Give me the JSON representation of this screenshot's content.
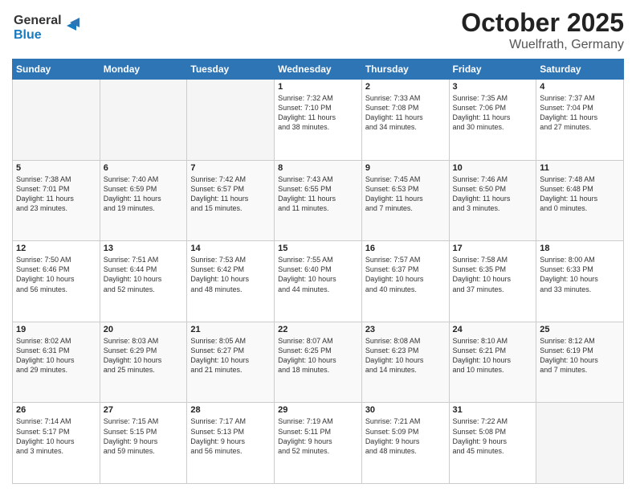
{
  "header": {
    "logo_line1": "General",
    "logo_line2": "Blue",
    "title": "October 2025",
    "subtitle": "Wuelfrath, Germany"
  },
  "days_of_week": [
    "Sunday",
    "Monday",
    "Tuesday",
    "Wednesday",
    "Thursday",
    "Friday",
    "Saturday"
  ],
  "weeks": [
    [
      {
        "day": "",
        "info": ""
      },
      {
        "day": "",
        "info": ""
      },
      {
        "day": "",
        "info": ""
      },
      {
        "day": "1",
        "info": "Sunrise: 7:32 AM\nSunset: 7:10 PM\nDaylight: 11 hours\nand 38 minutes."
      },
      {
        "day": "2",
        "info": "Sunrise: 7:33 AM\nSunset: 7:08 PM\nDaylight: 11 hours\nand 34 minutes."
      },
      {
        "day": "3",
        "info": "Sunrise: 7:35 AM\nSunset: 7:06 PM\nDaylight: 11 hours\nand 30 minutes."
      },
      {
        "day": "4",
        "info": "Sunrise: 7:37 AM\nSunset: 7:04 PM\nDaylight: 11 hours\nand 27 minutes."
      }
    ],
    [
      {
        "day": "5",
        "info": "Sunrise: 7:38 AM\nSunset: 7:01 PM\nDaylight: 11 hours\nand 23 minutes."
      },
      {
        "day": "6",
        "info": "Sunrise: 7:40 AM\nSunset: 6:59 PM\nDaylight: 11 hours\nand 19 minutes."
      },
      {
        "day": "7",
        "info": "Sunrise: 7:42 AM\nSunset: 6:57 PM\nDaylight: 11 hours\nand 15 minutes."
      },
      {
        "day": "8",
        "info": "Sunrise: 7:43 AM\nSunset: 6:55 PM\nDaylight: 11 hours\nand 11 minutes."
      },
      {
        "day": "9",
        "info": "Sunrise: 7:45 AM\nSunset: 6:53 PM\nDaylight: 11 hours\nand 7 minutes."
      },
      {
        "day": "10",
        "info": "Sunrise: 7:46 AM\nSunset: 6:50 PM\nDaylight: 11 hours\nand 3 minutes."
      },
      {
        "day": "11",
        "info": "Sunrise: 7:48 AM\nSunset: 6:48 PM\nDaylight: 11 hours\nand 0 minutes."
      }
    ],
    [
      {
        "day": "12",
        "info": "Sunrise: 7:50 AM\nSunset: 6:46 PM\nDaylight: 10 hours\nand 56 minutes."
      },
      {
        "day": "13",
        "info": "Sunrise: 7:51 AM\nSunset: 6:44 PM\nDaylight: 10 hours\nand 52 minutes."
      },
      {
        "day": "14",
        "info": "Sunrise: 7:53 AM\nSunset: 6:42 PM\nDaylight: 10 hours\nand 48 minutes."
      },
      {
        "day": "15",
        "info": "Sunrise: 7:55 AM\nSunset: 6:40 PM\nDaylight: 10 hours\nand 44 minutes."
      },
      {
        "day": "16",
        "info": "Sunrise: 7:57 AM\nSunset: 6:37 PM\nDaylight: 10 hours\nand 40 minutes."
      },
      {
        "day": "17",
        "info": "Sunrise: 7:58 AM\nSunset: 6:35 PM\nDaylight: 10 hours\nand 37 minutes."
      },
      {
        "day": "18",
        "info": "Sunrise: 8:00 AM\nSunset: 6:33 PM\nDaylight: 10 hours\nand 33 minutes."
      }
    ],
    [
      {
        "day": "19",
        "info": "Sunrise: 8:02 AM\nSunset: 6:31 PM\nDaylight: 10 hours\nand 29 minutes."
      },
      {
        "day": "20",
        "info": "Sunrise: 8:03 AM\nSunset: 6:29 PM\nDaylight: 10 hours\nand 25 minutes."
      },
      {
        "day": "21",
        "info": "Sunrise: 8:05 AM\nSunset: 6:27 PM\nDaylight: 10 hours\nand 21 minutes."
      },
      {
        "day": "22",
        "info": "Sunrise: 8:07 AM\nSunset: 6:25 PM\nDaylight: 10 hours\nand 18 minutes."
      },
      {
        "day": "23",
        "info": "Sunrise: 8:08 AM\nSunset: 6:23 PM\nDaylight: 10 hours\nand 14 minutes."
      },
      {
        "day": "24",
        "info": "Sunrise: 8:10 AM\nSunset: 6:21 PM\nDaylight: 10 hours\nand 10 minutes."
      },
      {
        "day": "25",
        "info": "Sunrise: 8:12 AM\nSunset: 6:19 PM\nDaylight: 10 hours\nand 7 minutes."
      }
    ],
    [
      {
        "day": "26",
        "info": "Sunrise: 7:14 AM\nSunset: 5:17 PM\nDaylight: 10 hours\nand 3 minutes."
      },
      {
        "day": "27",
        "info": "Sunrise: 7:15 AM\nSunset: 5:15 PM\nDaylight: 9 hours\nand 59 minutes."
      },
      {
        "day": "28",
        "info": "Sunrise: 7:17 AM\nSunset: 5:13 PM\nDaylight: 9 hours\nand 56 minutes."
      },
      {
        "day": "29",
        "info": "Sunrise: 7:19 AM\nSunset: 5:11 PM\nDaylight: 9 hours\nand 52 minutes."
      },
      {
        "day": "30",
        "info": "Sunrise: 7:21 AM\nSunset: 5:09 PM\nDaylight: 9 hours\nand 48 minutes."
      },
      {
        "day": "31",
        "info": "Sunrise: 7:22 AM\nSunset: 5:08 PM\nDaylight: 9 hours\nand 45 minutes."
      },
      {
        "day": "",
        "info": ""
      }
    ]
  ]
}
